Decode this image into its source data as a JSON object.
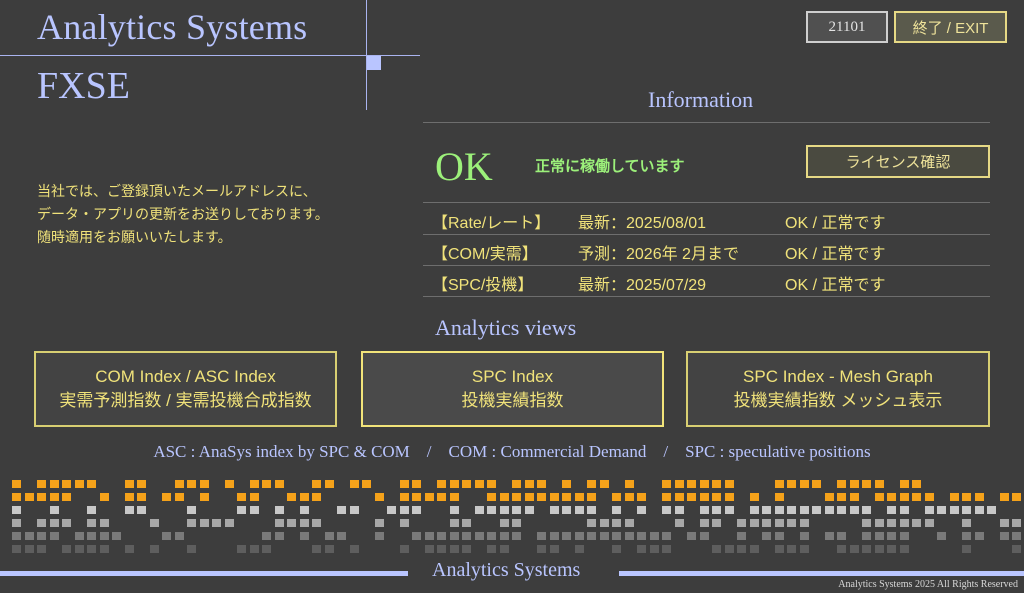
{
  "brand": {
    "title": "Analytics Systems",
    "product": "FXSE"
  },
  "header": {
    "code_label": "21101",
    "exit_label": "終了 / EXIT"
  },
  "notice": {
    "lines": [
      "当社では、ご登録頂いたメールアドレスに、",
      "データ・アプリの更新をお送りしております。",
      "随時適用をお願いいたします。"
    ]
  },
  "info": {
    "title": "Information",
    "status_big": "OK",
    "status_message": "正常に稼働しています",
    "license_label": "ライセンス確認",
    "rows": [
      {
        "label": "【Rate/レート】",
        "date": "最新：2025/08/01",
        "status": "OK / 正常です"
      },
      {
        "label": "【COM/実需】",
        "date": "予測：2026年 2月まで",
        "status": "OK / 正常です"
      },
      {
        "label": "【SPC/投機】",
        "date": "最新：2025/07/29",
        "status": "OK / 正常です"
      }
    ]
  },
  "views": {
    "title": "Analytics views",
    "buttons": [
      {
        "line1": "COM Index / ASC Index",
        "line2": "実需予測指数 / 実需投機合成指数"
      },
      {
        "line1": "SPC Index",
        "line2": "投機実績指数"
      },
      {
        "line1": "SPC Index - Mesh Graph",
        "line2": "投機実績指数 メッシュ表示"
      }
    ],
    "legend": "ASC : AnaSys index by SPC & COM　/　COM : Commercial  Demand　/　SPC : speculative  positions"
  },
  "footer": {
    "title": "Analytics Systems",
    "copyright": "Analytics Systems 2025 All Rights Reserved"
  },
  "colors": {
    "background": "#3d3d3d",
    "accent_blue": "#b9c5ff",
    "accent_yellow": "#f0e27a",
    "ok_green": "#9cf07a",
    "dot_orange": "#f5a21a",
    "dot_grey": "#c8c8c8"
  }
}
